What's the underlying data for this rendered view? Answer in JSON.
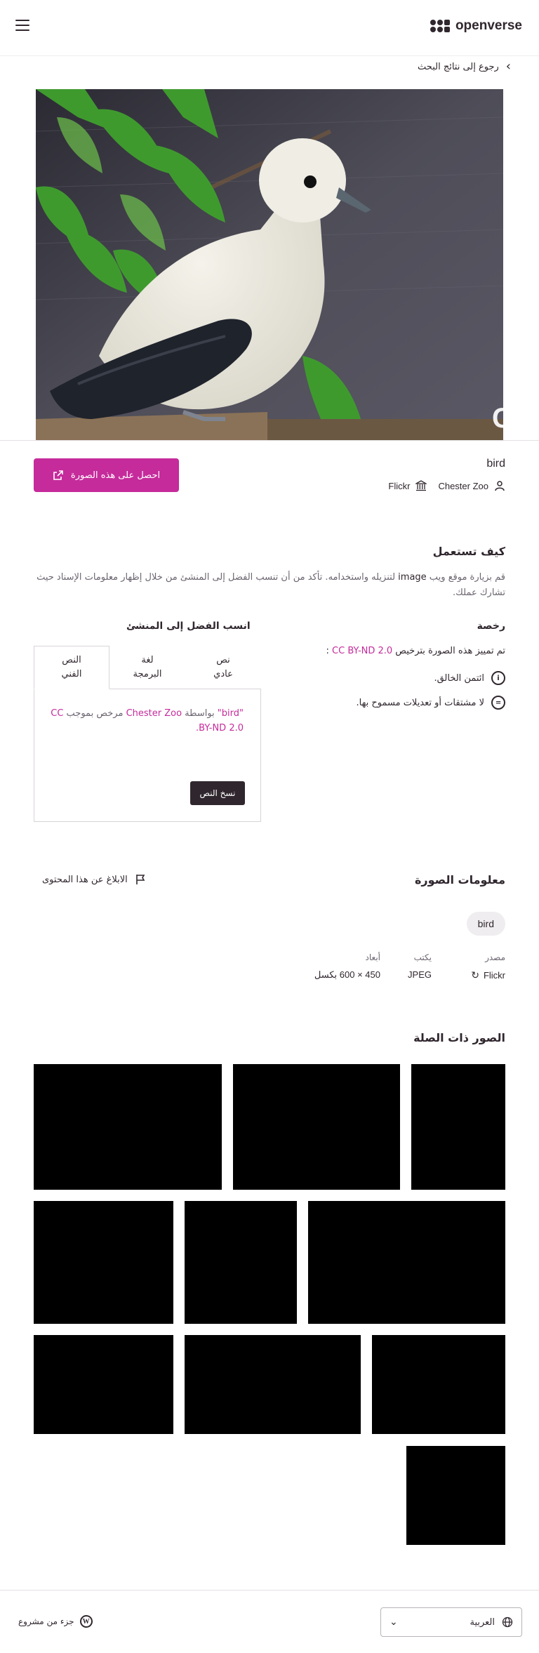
{
  "header": {
    "brand": "openverse",
    "menu_icon": "hamburger-menu-icon"
  },
  "nav": {
    "back_label": "رجوع إلى نتائج البحث"
  },
  "image": {
    "watermark": "ChesterZoo.org",
    "title": "bird",
    "creator": "Chester Zoo",
    "source": "Flickr",
    "get_button": "احصل على هذه الصورة"
  },
  "how_to_use": {
    "heading": "كيف تستعمل",
    "para_before": "قم بزيارة موقع ويب ",
    "para_em": "image",
    "para_after": " لتنزيله واستخدامه. تأكد من أن تنسب الفضل إلى المنشئ من خلال إظهار معلومات الإسناد حيث تشارك عملك."
  },
  "license": {
    "heading": "رخصة",
    "marked_text": "تم تمييز هذه الصورة بترخيص ",
    "license_name": "CC BY-ND 2.0",
    "marked_suffix": " :",
    "by_text": "ائتمن الخالق.",
    "nd_text": "لا مشتقات أو تعديلات مسموح بها."
  },
  "attribution": {
    "heading": "انسب الفضل إلى المنشئ",
    "tabs": [
      {
        "label": "النص الفني"
      },
      {
        "label": "لغة البرمجة"
      },
      {
        "label": "نص عادي"
      }
    ],
    "text_title": "\"bird\"",
    "text_by": " بواسطة ",
    "text_creator": "Chester Zoo",
    "text_licensed": " مرخص بموجب ",
    "text_license": "CC BY-ND 2.0",
    "text_end": ".",
    "copy_button": "نسخ النص"
  },
  "image_info": {
    "heading": "معلومات الصورة",
    "report_label": "الابلاغ عن هذا المحتوى",
    "tag": "bird",
    "source_label": "مصدر",
    "source_value": "Flickr",
    "type_label": "يكتب",
    "type_value": "JPEG",
    "dim_label": "أبعاد",
    "dim_value": "450 × 600 بكسل"
  },
  "related": {
    "heading": "الصور ذات الصلة"
  },
  "footer": {
    "project_label": "جزء من مشروع",
    "language": "العربية"
  },
  "colors": {
    "accent": "#c52b9b",
    "text": "#30272e",
    "muted": "#6c6570"
  }
}
